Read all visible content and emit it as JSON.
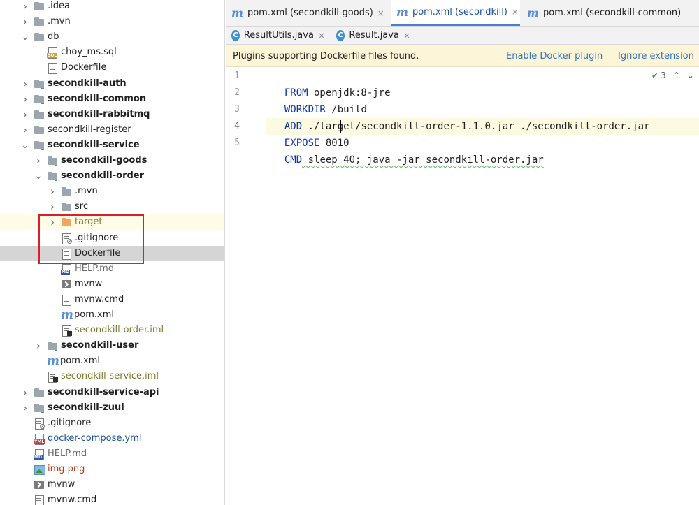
{
  "tree": {
    "items": [
      {
        "label": ".idea",
        "arrow": "right",
        "icon": "folder",
        "style": "normal",
        "color": "black"
      },
      {
        "label": ".mvn",
        "arrow": "right",
        "icon": "folder",
        "style": "normal",
        "color": "black"
      },
      {
        "label": "db",
        "arrow": "down",
        "icon": "folder",
        "style": "normal",
        "color": "black"
      },
      {
        "label": "choy_ms.sql",
        "arrow": "none",
        "icon": "sql-file",
        "style": "normal",
        "color": "black"
      },
      {
        "label": "Dockerfile",
        "arrow": "none",
        "icon": "file",
        "style": "normal",
        "color": "black"
      },
      {
        "label": "secondkill-auth",
        "arrow": "right",
        "icon": "module-folder",
        "style": "bold",
        "color": "black"
      },
      {
        "label": "secondkill-common",
        "arrow": "right",
        "icon": "module-folder",
        "style": "bold",
        "color": "black"
      },
      {
        "label": "secondkill-rabbitmq",
        "arrow": "right",
        "icon": "module-folder",
        "style": "bold",
        "color": "black"
      },
      {
        "label": "secondkill-register",
        "arrow": "right",
        "icon": "folder",
        "style": "normal",
        "color": "black"
      },
      {
        "label": "secondkill-service",
        "arrow": "down",
        "icon": "module-folder",
        "style": "bold",
        "color": "black"
      },
      {
        "label": "secondkill-goods",
        "arrow": "right",
        "icon": "module-folder",
        "style": "bold",
        "color": "black"
      },
      {
        "label": "secondkill-order",
        "arrow": "down",
        "icon": "module-folder",
        "style": "bold",
        "color": "black"
      },
      {
        "label": ".mvn",
        "arrow": "right",
        "icon": "folder",
        "style": "normal",
        "color": "black"
      },
      {
        "label": "src",
        "arrow": "right",
        "icon": "folder",
        "style": "normal",
        "color": "black"
      },
      {
        "label": "target",
        "arrow": "right",
        "icon": "orange-folder",
        "style": "normal",
        "color": "olive"
      },
      {
        "label": ".gitignore",
        "arrow": "none",
        "icon": "gitignore-file",
        "style": "normal",
        "color": "black"
      },
      {
        "label": "Dockerfile",
        "arrow": "none",
        "icon": "file",
        "style": "normal",
        "color": "black"
      },
      {
        "label": "HELP.md",
        "arrow": "none",
        "icon": "md-file",
        "style": "normal",
        "color": "gray"
      },
      {
        "label": "mvnw",
        "arrow": "none",
        "icon": "terminal-file",
        "style": "normal",
        "color": "black"
      },
      {
        "label": "mvnw.cmd",
        "arrow": "none",
        "icon": "file",
        "style": "normal",
        "color": "black"
      },
      {
        "label": "pom.xml",
        "arrow": "none",
        "icon": "maven-file",
        "style": "normal",
        "color": "black"
      },
      {
        "label": "secondkill-order.iml",
        "arrow": "none",
        "icon": "iml-file",
        "style": "normal",
        "color": "olive"
      },
      {
        "label": "secondkill-user",
        "arrow": "right",
        "icon": "module-folder",
        "style": "bold",
        "color": "black"
      },
      {
        "label": "pom.xml",
        "arrow": "none",
        "icon": "maven-file",
        "style": "normal",
        "color": "black"
      },
      {
        "label": "secondkill-service.iml",
        "arrow": "none",
        "icon": "iml-file",
        "style": "normal",
        "color": "olive"
      },
      {
        "label": "secondkill-service-api",
        "arrow": "right",
        "icon": "module-folder",
        "style": "bold",
        "color": "black"
      },
      {
        "label": "secondkill-zuul",
        "arrow": "right",
        "icon": "module-folder",
        "style": "bold",
        "color": "black"
      },
      {
        "label": ".gitignore",
        "arrow": "none",
        "icon": "gitignore-file",
        "style": "normal",
        "color": "black"
      },
      {
        "label": "docker-compose.yml",
        "arrow": "none",
        "icon": "yml-file",
        "style": "normal",
        "color": "blue"
      },
      {
        "label": "HELP.md",
        "arrow": "none",
        "icon": "md-file",
        "style": "normal",
        "color": "gray"
      },
      {
        "label": "img.png",
        "arrow": "none",
        "icon": "png-file",
        "style": "normal",
        "color": "red"
      },
      {
        "label": "mvnw",
        "arrow": "none",
        "icon": "terminal-file",
        "style": "normal",
        "color": "black"
      },
      {
        "label": "mvnw.cmd",
        "arrow": "none",
        "icon": "file",
        "style": "normal",
        "color": "black"
      }
    ],
    "badges": {
      "sql": "SQL",
      "yml": "YML",
      "md": "MD"
    }
  },
  "tabs_row1": [
    {
      "label": "pom.xml (secondkill-goods)",
      "icon": "maven-icon",
      "active": false
    },
    {
      "label": "pom.xml (secondkill)",
      "icon": "maven-icon",
      "active": true
    },
    {
      "label": "pom.xml (secondkill-common)",
      "icon": "maven-icon",
      "active": false
    }
  ],
  "tabs_row2": [
    {
      "label": "ResultUtils.java",
      "icon": "class-icon",
      "active": false
    },
    {
      "label": "Result.java",
      "icon": "class-icon",
      "active": false
    }
  ],
  "tab_icons": {
    "maven": "m",
    "class": "C",
    "close": "×"
  },
  "banner": {
    "text": "Plugins supporting Dockerfile files found.",
    "enable": "Enable Docker plugin",
    "ignore": "Ignore extension"
  },
  "editor": {
    "lines": [
      {
        "num": "1",
        "kw": "FROM",
        "rest": " openjdk:8-jre"
      },
      {
        "num": "2",
        "kw": "WORKDIR",
        "rest": " /build"
      },
      {
        "num": "3",
        "kw": "ADD",
        "rest": " ./target/secondkill-order-1.1.0.jar ./secondkill-order.jar"
      },
      {
        "num": "4",
        "kw": "EXPOSE",
        "rest": " 8010"
      },
      {
        "num": "5",
        "kw": "CMD",
        "rest": " sleep 40; java -jar secondkill-order.jar"
      }
    ],
    "inspection_count": "3",
    "current_line": "4"
  },
  "colors": {
    "keyword": "#0b35a8",
    "link": "#3273c4",
    "banner_bg": "#fdf5d7",
    "highlight_box": "#d6202a",
    "active_tab_underline": "#4c7bd6"
  }
}
